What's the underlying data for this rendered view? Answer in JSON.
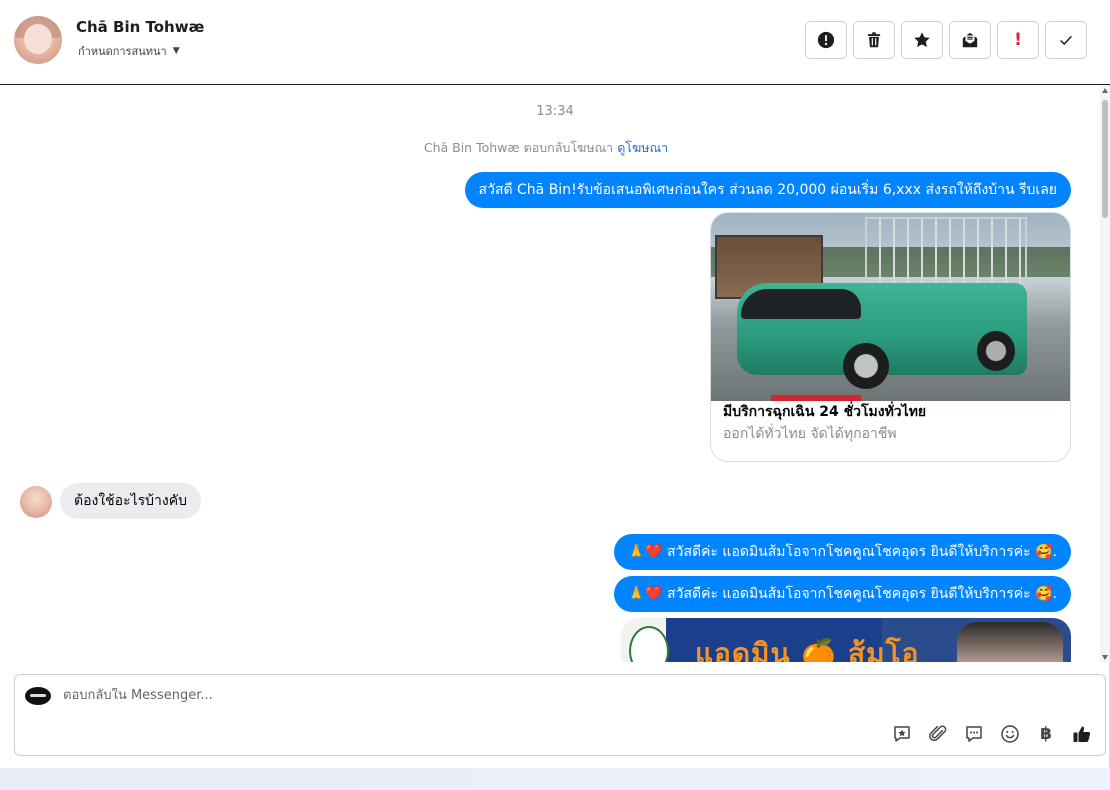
{
  "header": {
    "contact_name": "Chā Bin Tohwæ",
    "assign_label": "กำหนดการสนทนา"
  },
  "toolbar": {
    "buttons": [
      {
        "name": "spam-report",
        "icon": "exclamation-circle-icon"
      },
      {
        "name": "delete",
        "icon": "trash-icon"
      },
      {
        "name": "star",
        "icon": "star-icon"
      },
      {
        "name": "mark-unread",
        "icon": "envelope-open-icon"
      },
      {
        "name": "follow-up",
        "icon": "red-exclamation-icon",
        "label": "!"
      },
      {
        "name": "mark-done",
        "icon": "check-icon"
      }
    ]
  },
  "conversation": {
    "timestamp": "13:34",
    "ad_reply_notice": {
      "text": "Chā Bin Tohwæ ตอบกลับโฆษณา",
      "link": "ดูโฆษณา"
    },
    "messages": [
      {
        "direction": "out",
        "text": "สวัสดี Chā Bin!รับข้อเสนอพิเศษก่อนใคร ส่วนลด 20,000 ผ่อนเริ่ม 6,xxx ส่งรถให้ถึงบ้าน รีบเลย"
      },
      {
        "direction": "in",
        "text": "ต้องใช้อะไรบ้างคับ"
      },
      {
        "direction": "out",
        "text": "🙏❤️ สวัสดีค่ะ แอดมินส้มโอจากโชคคูณโชคอุดร ยินดีให้บริการค่ะ 🥰."
      },
      {
        "direction": "out",
        "text": "🙏❤️ สวัสดีค่ะ แอดมินส้มโอจากโชคคูณโชคอุดร ยินดีให้บริการค่ะ 🥰."
      }
    ],
    "ad_card": {
      "title": "มีบริการฉุกเฉิน 24 ชั่วโมงทั่วไทย",
      "subtitle": "ออกได้ทั่วไทย จัดได้ทุกอาชีพ"
    },
    "image_banner_text": "แอดมิน 🍊 ส้มโอ"
  },
  "composer": {
    "placeholder": "ตอบกลับใน Messenger...",
    "tools": [
      "saved-reply-icon",
      "attachment-icon",
      "chat-icon",
      "emoji-icon",
      "baht-icon",
      "thumbs-up-icon"
    ],
    "currency_symbol": "฿"
  },
  "colors": {
    "accent": "#0084ff",
    "incoming_bubble": "#ebecf0",
    "link": "#216fdb",
    "muted": "#8a8d91"
  }
}
